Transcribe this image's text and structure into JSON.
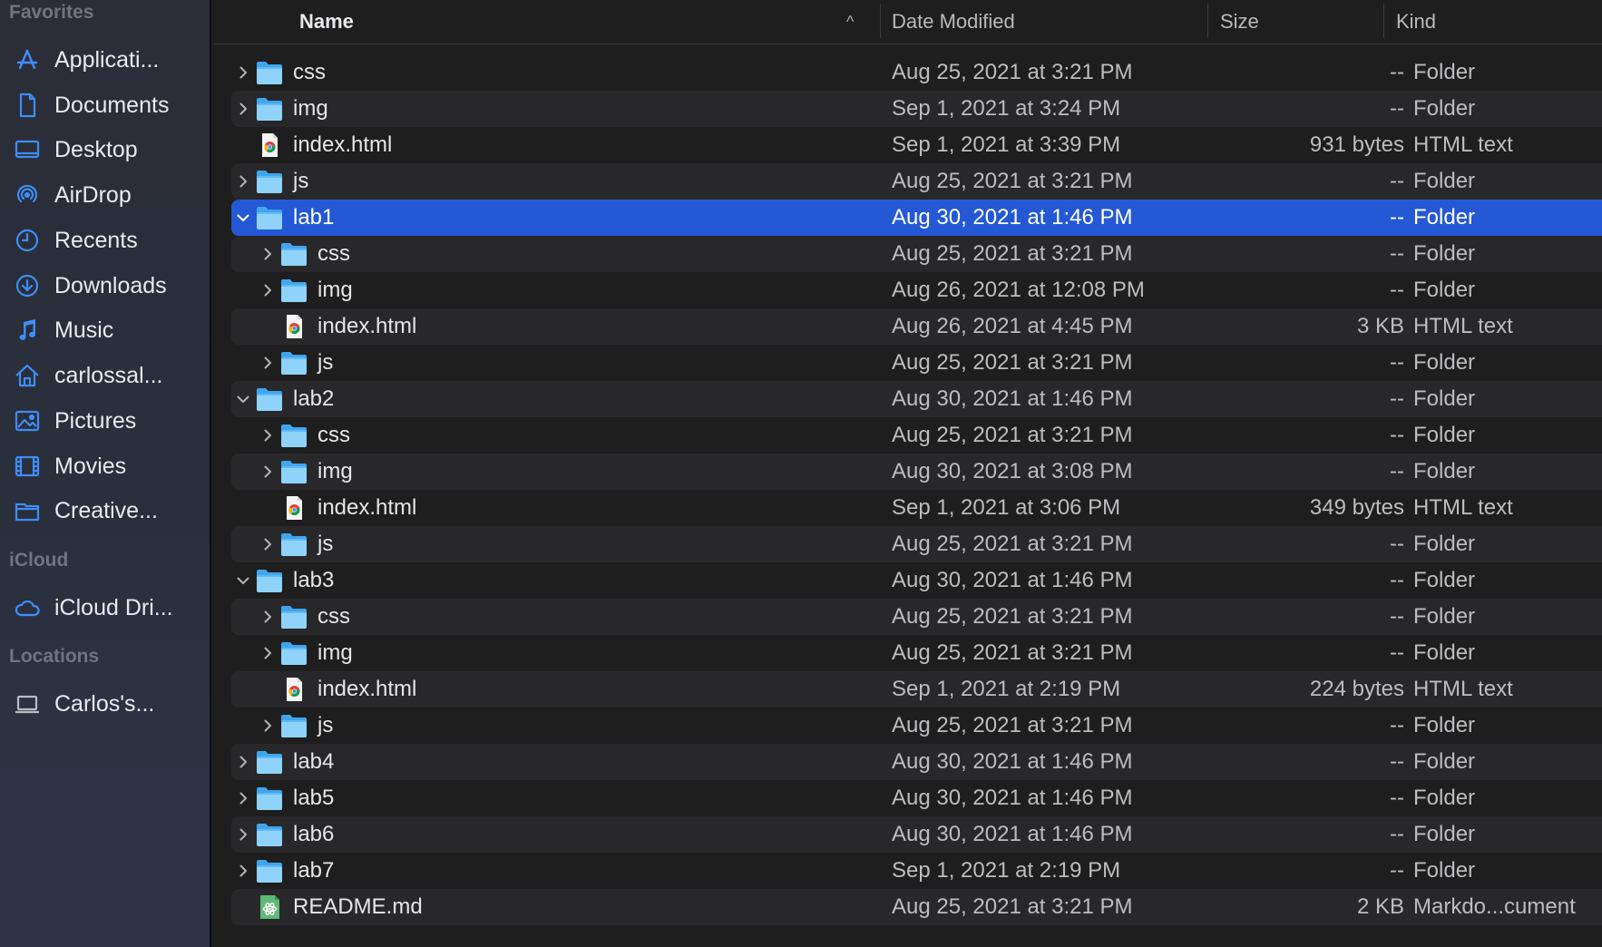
{
  "sidebar": {
    "sections": [
      {
        "title": "Favorites",
        "items": [
          {
            "label": "Applicati...",
            "icon": "applications-icon"
          },
          {
            "label": "Documents",
            "icon": "document-icon"
          },
          {
            "label": "Desktop",
            "icon": "desktop-icon"
          },
          {
            "label": "AirDrop",
            "icon": "airdrop-icon"
          },
          {
            "label": "Recents",
            "icon": "clock-icon"
          },
          {
            "label": "Downloads",
            "icon": "download-icon"
          },
          {
            "label": "Music",
            "icon": "music-icon"
          },
          {
            "label": "carlossal...",
            "icon": "home-icon"
          },
          {
            "label": "Pictures",
            "icon": "pictures-icon"
          },
          {
            "label": "Movies",
            "icon": "film-icon"
          },
          {
            "label": "Creative...",
            "icon": "folder-icon"
          }
        ]
      },
      {
        "title": "iCloud",
        "items": [
          {
            "label": "iCloud Dri...",
            "icon": "cloud-icon"
          }
        ]
      },
      {
        "title": "Locations",
        "items": [
          {
            "label": "Carlos's...",
            "icon": "laptop-icon"
          }
        ]
      }
    ]
  },
  "header": {
    "name": "Name",
    "date": "Date Modified",
    "size": "Size",
    "kind": "Kind",
    "sort_indicator": "^"
  },
  "files": [
    {
      "name": "css",
      "date": "Aug 25, 2021 at 3:21 PM",
      "size": "--",
      "kind": "Folder",
      "level": 0,
      "type": "folder",
      "disclosure": "collapsed"
    },
    {
      "name": "img",
      "date": "Sep 1, 2021 at 3:24 PM",
      "size": "--",
      "kind": "Folder",
      "level": 0,
      "type": "folder",
      "disclosure": "collapsed"
    },
    {
      "name": "index.html",
      "date": "Sep 1, 2021 at 3:39 PM",
      "size": "931 bytes",
      "kind": "HTML text",
      "level": 0,
      "type": "html",
      "disclosure": "none"
    },
    {
      "name": "js",
      "date": "Aug 25, 2021 at 3:21 PM",
      "size": "--",
      "kind": "Folder",
      "level": 0,
      "type": "folder",
      "disclosure": "collapsed"
    },
    {
      "name": "lab1",
      "date": "Aug 30, 2021 at 1:46 PM",
      "size": "--",
      "kind": "Folder",
      "level": 0,
      "type": "folder",
      "disclosure": "expanded",
      "selected": true
    },
    {
      "name": "css",
      "date": "Aug 25, 2021 at 3:21 PM",
      "size": "--",
      "kind": "Folder",
      "level": 1,
      "type": "folder",
      "disclosure": "collapsed"
    },
    {
      "name": "img",
      "date": "Aug 26, 2021 at 12:08 PM",
      "size": "--",
      "kind": "Folder",
      "level": 1,
      "type": "folder",
      "disclosure": "collapsed"
    },
    {
      "name": "index.html",
      "date": "Aug 26, 2021 at 4:45 PM",
      "size": "3 KB",
      "kind": "HTML text",
      "level": 1,
      "type": "html",
      "disclosure": "none"
    },
    {
      "name": "js",
      "date": "Aug 25, 2021 at 3:21 PM",
      "size": "--",
      "kind": "Folder",
      "level": 1,
      "type": "folder",
      "disclosure": "collapsed"
    },
    {
      "name": "lab2",
      "date": "Aug 30, 2021 at 1:46 PM",
      "size": "--",
      "kind": "Folder",
      "level": 0,
      "type": "folder",
      "disclosure": "expanded"
    },
    {
      "name": "css",
      "date": "Aug 25, 2021 at 3:21 PM",
      "size": "--",
      "kind": "Folder",
      "level": 1,
      "type": "folder",
      "disclosure": "collapsed"
    },
    {
      "name": "img",
      "date": "Aug 30, 2021 at 3:08 PM",
      "size": "--",
      "kind": "Folder",
      "level": 1,
      "type": "folder",
      "disclosure": "collapsed"
    },
    {
      "name": "index.html",
      "date": "Sep 1, 2021 at 3:06 PM",
      "size": "349 bytes",
      "kind": "HTML text",
      "level": 1,
      "type": "html",
      "disclosure": "none"
    },
    {
      "name": "js",
      "date": "Aug 25, 2021 at 3:21 PM",
      "size": "--",
      "kind": "Folder",
      "level": 1,
      "type": "folder",
      "disclosure": "collapsed"
    },
    {
      "name": "lab3",
      "date": "Aug 30, 2021 at 1:46 PM",
      "size": "--",
      "kind": "Folder",
      "level": 0,
      "type": "folder",
      "disclosure": "expanded"
    },
    {
      "name": "css",
      "date": "Aug 25, 2021 at 3:21 PM",
      "size": "--",
      "kind": "Folder",
      "level": 1,
      "type": "folder",
      "disclosure": "collapsed"
    },
    {
      "name": "img",
      "date": "Aug 25, 2021 at 3:21 PM",
      "size": "--",
      "kind": "Folder",
      "level": 1,
      "type": "folder",
      "disclosure": "collapsed"
    },
    {
      "name": "index.html",
      "date": "Sep 1, 2021 at 2:19 PM",
      "size": "224 bytes",
      "kind": "HTML text",
      "level": 1,
      "type": "html",
      "disclosure": "none"
    },
    {
      "name": "js",
      "date": "Aug 25, 2021 at 3:21 PM",
      "size": "--",
      "kind": "Folder",
      "level": 1,
      "type": "folder",
      "disclosure": "collapsed"
    },
    {
      "name": "lab4",
      "date": "Aug 30, 2021 at 1:46 PM",
      "size": "--",
      "kind": "Folder",
      "level": 0,
      "type": "folder",
      "disclosure": "collapsed"
    },
    {
      "name": "lab5",
      "date": "Aug 30, 2021 at 1:46 PM",
      "size": "--",
      "kind": "Folder",
      "level": 0,
      "type": "folder",
      "disclosure": "collapsed"
    },
    {
      "name": "lab6",
      "date": "Aug 30, 2021 at 1:46 PM",
      "size": "--",
      "kind": "Folder",
      "level": 0,
      "type": "folder",
      "disclosure": "collapsed"
    },
    {
      "name": "lab7",
      "date": "Sep 1, 2021 at 2:19 PM",
      "size": "--",
      "kind": "Folder",
      "level": 0,
      "type": "folder",
      "disclosure": "collapsed"
    },
    {
      "name": "README.md",
      "date": "Aug 25, 2021 at 3:21 PM",
      "size": "2 KB",
      "kind": "Markdo...cument",
      "level": 0,
      "type": "markdown",
      "disclosure": "none"
    }
  ],
  "colors": {
    "selection": "#2458d4",
    "folder_light": "#8fd3fb",
    "folder_dark": "#3fa6ee",
    "accent": "#3d8ef7"
  }
}
